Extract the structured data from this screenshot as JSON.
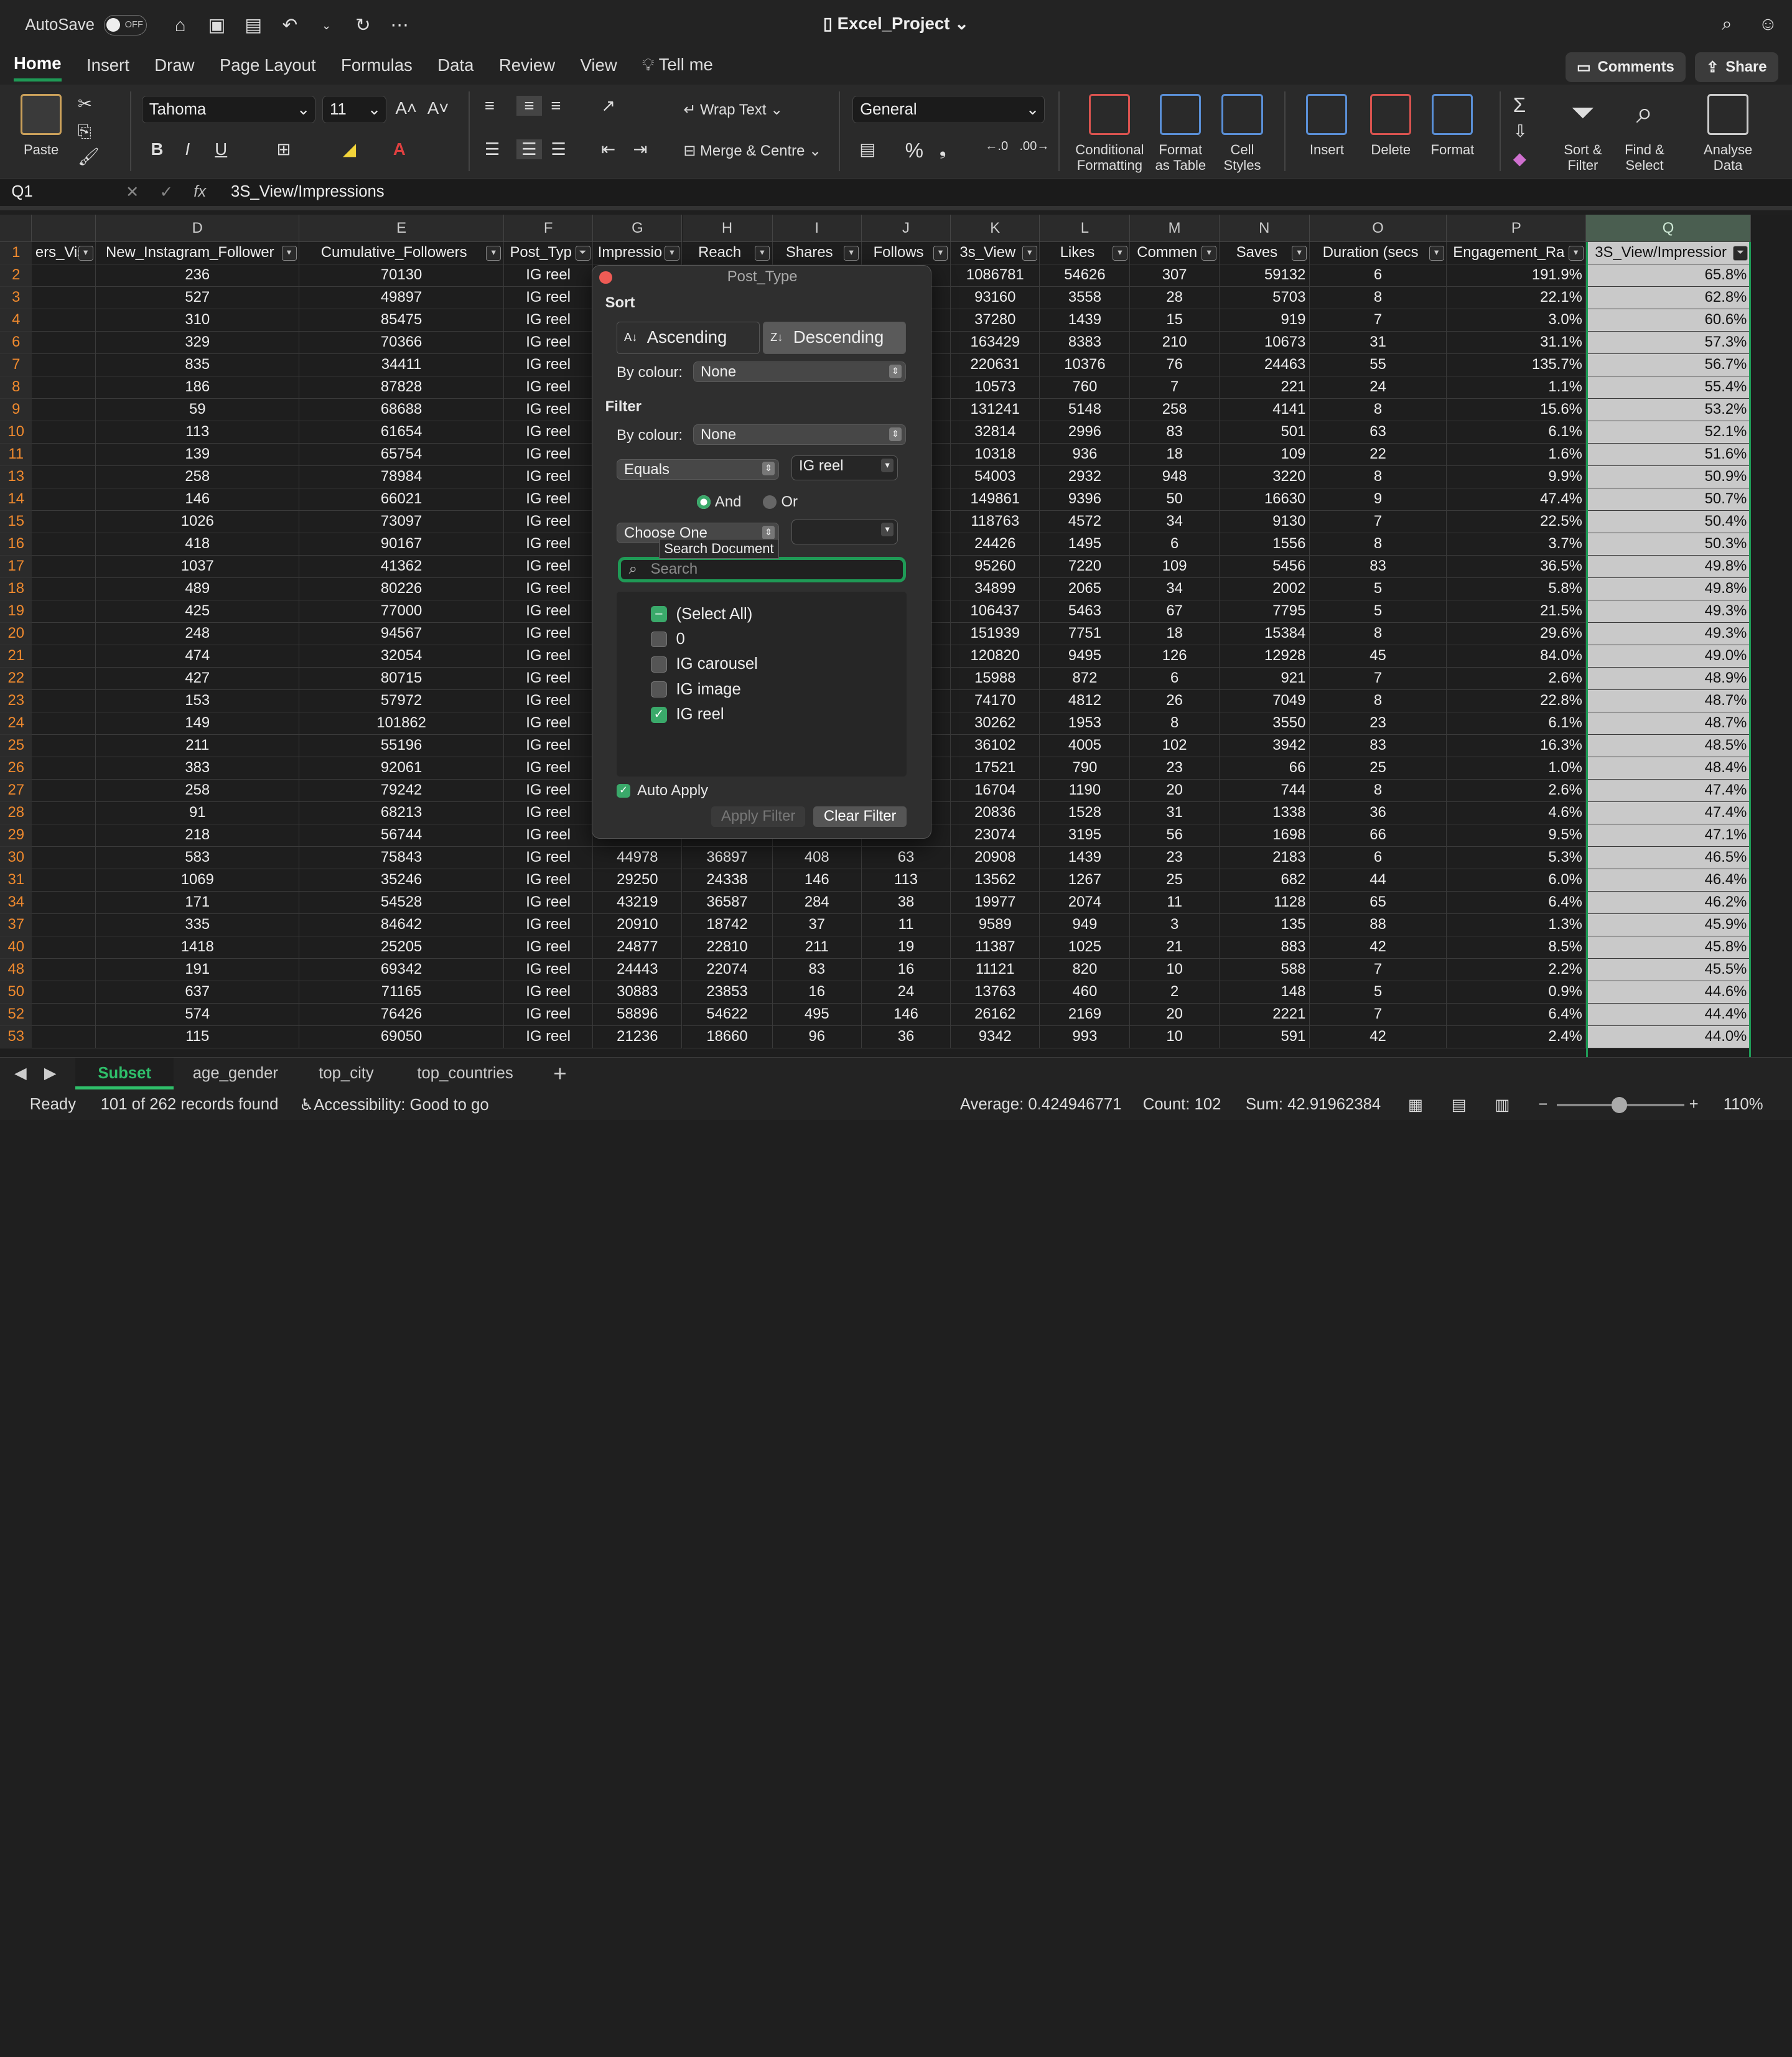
{
  "app": {
    "title": "Excel_Project",
    "autosave_label": "AutoSave",
    "autosave_state": "OFF",
    "accent": "#1f9a56"
  },
  "tabs": [
    "Home",
    "Insert",
    "Draw",
    "Page Layout",
    "Formulas",
    "Data",
    "Review",
    "View",
    "Tell me"
  ],
  "top_right": {
    "comments": "Comments",
    "share": "Share"
  },
  "ribbon": {
    "paste": "Paste",
    "font_name": "Tahoma",
    "font_size": "11",
    "wrap_text": "Wrap Text",
    "merge_centre": "Merge & Centre",
    "number_format": "General",
    "conditional_formatting": [
      "Conditional",
      "Formatting"
    ],
    "format_as_table": [
      "Format",
      "as Table"
    ],
    "cell_styles": [
      "Cell",
      "Styles"
    ],
    "insert": "Insert",
    "delete": "Delete",
    "format": "Format",
    "sort_filter": [
      "Sort &",
      "Filter"
    ],
    "find_select": [
      "Find &",
      "Select"
    ],
    "analyse_data": [
      "Analyse",
      "Data"
    ],
    "bold": "B",
    "italic": "I",
    "underline": "U"
  },
  "formula_bar": {
    "name_box": "Q1",
    "fx": "fx",
    "formula": "3S_View/Impressions"
  },
  "columns": [
    {
      "letter": "",
      "header": "ers_Vis"
    },
    {
      "letter": "D",
      "header": "New_Instagram_Follower"
    },
    {
      "letter": "E",
      "header": "Cumulative_Followers"
    },
    {
      "letter": "F",
      "header": "Post_Typ"
    },
    {
      "letter": "G",
      "header": "Impressio"
    },
    {
      "letter": "H",
      "header": "Reach"
    },
    {
      "letter": "I",
      "header": "Shares"
    },
    {
      "letter": "J",
      "header": "Follows"
    },
    {
      "letter": "K",
      "header": "3s_View"
    },
    {
      "letter": "L",
      "header": "Likes"
    },
    {
      "letter": "M",
      "header": "Commen"
    },
    {
      "letter": "N",
      "header": "Saves"
    },
    {
      "letter": "O",
      "header": "Duration (secs"
    },
    {
      "letter": "P",
      "header": "Engagement_Ra"
    },
    {
      "letter": "Q",
      "header": "3S_View/Impressior"
    }
  ],
  "header_row_num": "1",
  "rows": [
    {
      "n": "2",
      "D": "236",
      "E": "70130",
      "F": "IG reel",
      "G": "",
      "H": "",
      "I": "",
      "J": "",
      "K": "1086781",
      "L": "54626",
      "M": "307",
      "N": "59132",
      "O": "6",
      "P": "191.9%",
      "Q": "65.8%"
    },
    {
      "n": "3",
      "D": "527",
      "E": "49897",
      "F": "IG reel",
      "G": "",
      "H": "",
      "I": "",
      "J": "",
      "K": "93160",
      "L": "3558",
      "M": "28",
      "N": "5703",
      "O": "8",
      "P": "22.1%",
      "Q": "62.8%"
    },
    {
      "n": "4",
      "D": "310",
      "E": "85475",
      "F": "IG reel",
      "G": "",
      "H": "",
      "I": "",
      "J": "",
      "K": "37280",
      "L": "1439",
      "M": "15",
      "N": "919",
      "O": "7",
      "P": "3.0%",
      "Q": "60.6%"
    },
    {
      "n": "6",
      "D": "329",
      "E": "70366",
      "F": "IG reel",
      "G": "",
      "H": "",
      "I": "",
      "J": "",
      "K": "163429",
      "L": "8383",
      "M": "210",
      "N": "10673",
      "O": "31",
      "P": "31.1%",
      "Q": "57.3%"
    },
    {
      "n": "7",
      "D": "835",
      "E": "34411",
      "F": "IG reel",
      "G": "",
      "H": "",
      "I": "",
      "J": "",
      "K": "220631",
      "L": "10376",
      "M": "76",
      "N": "24463",
      "O": "55",
      "P": "135.7%",
      "Q": "56.7%"
    },
    {
      "n": "8",
      "D": "186",
      "E": "87828",
      "F": "IG reel",
      "G": "",
      "H": "",
      "I": "",
      "J": "",
      "K": "10573",
      "L": "760",
      "M": "7",
      "N": "221",
      "O": "24",
      "P": "1.1%",
      "Q": "55.4%"
    },
    {
      "n": "9",
      "D": "59",
      "E": "68688",
      "F": "IG reel",
      "G": "",
      "H": "",
      "I": "",
      "J": "",
      "K": "131241",
      "L": "5148",
      "M": "258",
      "N": "4141",
      "O": "8",
      "P": "15.6%",
      "Q": "53.2%"
    },
    {
      "n": "10",
      "D": "113",
      "E": "61654",
      "F": "IG reel",
      "G": "",
      "H": "",
      "I": "",
      "J": "",
      "K": "32814",
      "L": "2996",
      "M": "83",
      "N": "501",
      "O": "63",
      "P": "6.1%",
      "Q": "52.1%"
    },
    {
      "n": "11",
      "D": "139",
      "E": "65754",
      "F": "IG reel",
      "G": "",
      "H": "",
      "I": "",
      "J": "",
      "K": "10318",
      "L": "936",
      "M": "18",
      "N": "109",
      "O": "22",
      "P": "1.6%",
      "Q": "51.6%"
    },
    {
      "n": "13",
      "D": "258",
      "E": "78984",
      "F": "IG reel",
      "G": "",
      "H": "",
      "I": "",
      "J": "",
      "K": "54003",
      "L": "2932",
      "M": "948",
      "N": "3220",
      "O": "8",
      "P": "9.9%",
      "Q": "50.9%"
    },
    {
      "n": "14",
      "D": "146",
      "E": "66021",
      "F": "IG reel",
      "G": "",
      "H": "",
      "I": "",
      "J": "",
      "K": "149861",
      "L": "9396",
      "M": "50",
      "N": "16630",
      "O": "9",
      "P": "47.4%",
      "Q": "50.7%"
    },
    {
      "n": "15",
      "D": "1026",
      "E": "73097",
      "F": "IG reel",
      "G": "",
      "H": "",
      "I": "",
      "J": "",
      "K": "118763",
      "L": "4572",
      "M": "34",
      "N": "9130",
      "O": "7",
      "P": "22.5%",
      "Q": "50.4%"
    },
    {
      "n": "16",
      "D": "418",
      "E": "90167",
      "F": "IG reel",
      "G": "",
      "H": "",
      "I": "",
      "J": "",
      "K": "24426",
      "L": "1495",
      "M": "6",
      "N": "1556",
      "O": "8",
      "P": "3.7%",
      "Q": "50.3%"
    },
    {
      "n": "17",
      "D": "1037",
      "E": "41362",
      "F": "IG reel",
      "G": "",
      "H": "",
      "I": "",
      "J": "",
      "K": "95260",
      "L": "7220",
      "M": "109",
      "N": "5456",
      "O": "83",
      "P": "36.5%",
      "Q": "49.8%"
    },
    {
      "n": "18",
      "D": "489",
      "E": "80226",
      "F": "IG reel",
      "G": "",
      "H": "",
      "I": "",
      "J": "",
      "K": "34899",
      "L": "2065",
      "M": "34",
      "N": "2002",
      "O": "5",
      "P": "5.8%",
      "Q": "49.8%"
    },
    {
      "n": "19",
      "D": "425",
      "E": "77000",
      "F": "IG reel",
      "G": "",
      "H": "",
      "I": "",
      "J": "",
      "K": "106437",
      "L": "5463",
      "M": "67",
      "N": "7795",
      "O": "5",
      "P": "21.5%",
      "Q": "49.3%"
    },
    {
      "n": "20",
      "D": "248",
      "E": "94567",
      "F": "IG reel",
      "G": "",
      "H": "",
      "I": "",
      "J": "",
      "K": "151939",
      "L": "7751",
      "M": "18",
      "N": "15384",
      "O": "8",
      "P": "29.6%",
      "Q": "49.3%"
    },
    {
      "n": "21",
      "D": "474",
      "E": "32054",
      "F": "IG reel",
      "G": "",
      "H": "",
      "I": "",
      "J": "",
      "K": "120820",
      "L": "9495",
      "M": "126",
      "N": "12928",
      "O": "45",
      "P": "84.0%",
      "Q": "49.0%"
    },
    {
      "n": "22",
      "D": "427",
      "E": "80715",
      "F": "IG reel",
      "G": "",
      "H": "",
      "I": "",
      "J": "",
      "K": "15988",
      "L": "872",
      "M": "6",
      "N": "921",
      "O": "7",
      "P": "2.6%",
      "Q": "48.9%"
    },
    {
      "n": "23",
      "D": "153",
      "E": "57972",
      "F": "IG reel",
      "G": "",
      "H": "",
      "I": "",
      "J": "",
      "K": "74170",
      "L": "4812",
      "M": "26",
      "N": "7049",
      "O": "8",
      "P": "22.8%",
      "Q": "48.7%"
    },
    {
      "n": "24",
      "D": "149",
      "E": "101862",
      "F": "IG reel",
      "G": "",
      "H": "",
      "I": "",
      "J": "",
      "K": "30262",
      "L": "1953",
      "M": "8",
      "N": "3550",
      "O": "23",
      "P": "6.1%",
      "Q": "48.7%"
    },
    {
      "n": "25",
      "D": "211",
      "E": "55196",
      "F": "IG reel",
      "G": "",
      "H": "",
      "I": "",
      "J": "",
      "K": "36102",
      "L": "4005",
      "M": "102",
      "N": "3942",
      "O": "83",
      "P": "16.3%",
      "Q": "48.5%"
    },
    {
      "n": "26",
      "D": "383",
      "E": "92061",
      "F": "IG reel",
      "G": "",
      "H": "",
      "I": "",
      "J": "",
      "K": "17521",
      "L": "790",
      "M": "23",
      "N": "66",
      "O": "25",
      "P": "1.0%",
      "Q": "48.4%"
    },
    {
      "n": "27",
      "D": "258",
      "E": "79242",
      "F": "IG reel",
      "G": "",
      "H": "",
      "I": "",
      "J": "",
      "K": "16704",
      "L": "1190",
      "M": "20",
      "N": "744",
      "O": "8",
      "P": "2.6%",
      "Q": "47.4%"
    },
    {
      "n": "28",
      "D": "91",
      "E": "68213",
      "F": "IG reel",
      "G": "",
      "H": "",
      "I": "",
      "J": "",
      "K": "20836",
      "L": "1528",
      "M": "31",
      "N": "1338",
      "O": "36",
      "P": "4.6%",
      "Q": "47.4%"
    },
    {
      "n": "29",
      "D": "218",
      "E": "56744",
      "F": "IG reel",
      "G": "",
      "H": "",
      "I": "",
      "J": "",
      "K": "23074",
      "L": "3195",
      "M": "56",
      "N": "1698",
      "O": "66",
      "P": "9.5%",
      "Q": "47.1%"
    },
    {
      "n": "30",
      "D": "583",
      "E": "75843",
      "F": "IG reel",
      "G": "44978",
      "H": "36897",
      "I": "408",
      "J": "63",
      "K": "20908",
      "L": "1439",
      "M": "23",
      "N": "2183",
      "O": "6",
      "P": "5.3%",
      "Q": "46.5%"
    },
    {
      "n": "31",
      "D": "1069",
      "E": "35246",
      "F": "IG reel",
      "G": "29250",
      "H": "24338",
      "I": "146",
      "J": "113",
      "K": "13562",
      "L": "1267",
      "M": "25",
      "N": "682",
      "O": "44",
      "P": "6.0%",
      "Q": "46.4%"
    },
    {
      "n": "34",
      "D": "171",
      "E": "54528",
      "F": "IG reel",
      "G": "43219",
      "H": "36587",
      "I": "284",
      "J": "38",
      "K": "19977",
      "L": "2074",
      "M": "11",
      "N": "1128",
      "O": "65",
      "P": "6.4%",
      "Q": "46.2%"
    },
    {
      "n": "37",
      "D": "335",
      "E": "84642",
      "F": "IG reel",
      "G": "20910",
      "H": "18742",
      "I": "37",
      "J": "11",
      "K": "9589",
      "L": "949",
      "M": "3",
      "N": "135",
      "O": "88",
      "P": "1.3%",
      "Q": "45.9%"
    },
    {
      "n": "40",
      "D": "1418",
      "E": "25205",
      "F": "IG reel",
      "G": "24877",
      "H": "22810",
      "I": "211",
      "J": "19",
      "K": "11387",
      "L": "1025",
      "M": "21",
      "N": "883",
      "O": "42",
      "P": "8.5%",
      "Q": "45.8%"
    },
    {
      "n": "48",
      "D": "191",
      "E": "69342",
      "F": "IG reel",
      "G": "24443",
      "H": "22074",
      "I": "83",
      "J": "16",
      "K": "11121",
      "L": "820",
      "M": "10",
      "N": "588",
      "O": "7",
      "P": "2.2%",
      "Q": "45.5%"
    },
    {
      "n": "50",
      "D": "637",
      "E": "71165",
      "F": "IG reel",
      "G": "30883",
      "H": "23853",
      "I": "16",
      "J": "24",
      "K": "13763",
      "L": "460",
      "M": "2",
      "N": "148",
      "O": "5",
      "P": "0.9%",
      "Q": "44.6%"
    },
    {
      "n": "52",
      "D": "574",
      "E": "76426",
      "F": "IG reel",
      "G": "58896",
      "H": "54622",
      "I": "495",
      "J": "146",
      "K": "26162",
      "L": "2169",
      "M": "20",
      "N": "2221",
      "O": "7",
      "P": "6.4%",
      "Q": "44.4%"
    },
    {
      "n": "53",
      "D": "115",
      "E": "69050",
      "F": "IG reel",
      "G": "21236",
      "H": "18660",
      "I": "96",
      "J": "36",
      "K": "9342",
      "L": "993",
      "M": "10",
      "N": "591",
      "O": "42",
      "P": "2.4%",
      "Q": "44.0%"
    }
  ],
  "filter": {
    "title": "Post_Type",
    "sort_heading": "Sort",
    "ascending": "Ascending",
    "descending": "Descending",
    "by_colour_label": "By colour:",
    "by_colour_value": "None",
    "filter_heading": "Filter",
    "filter_colour_value": "None",
    "condition1": "Equals",
    "value1": "IG reel",
    "and_label": "And",
    "or_label": "Or",
    "condition2": "Choose One",
    "tooltip": "Search Document",
    "search_placeholder": "Search",
    "items": [
      {
        "label": "(Select All)",
        "state": "partial"
      },
      {
        "label": "0",
        "state": "off"
      },
      {
        "label": "IG carousel",
        "state": "off"
      },
      {
        "label": "IG image",
        "state": "off"
      },
      {
        "label": "IG reel",
        "state": "on"
      }
    ],
    "auto_apply": "Auto Apply",
    "apply_filter": "Apply Filter",
    "clear_filter": "Clear Filter"
  },
  "sheets": [
    "Subset",
    "age_gender",
    "top_city",
    "top_countries"
  ],
  "status": {
    "ready": "Ready",
    "records": "101 of 262 records found",
    "accessibility": "Accessibility: Good to go",
    "average": "Average: 0.424946771",
    "count": "Count: 102",
    "sum": "Sum: 42.91962384",
    "zoom": "110%"
  }
}
